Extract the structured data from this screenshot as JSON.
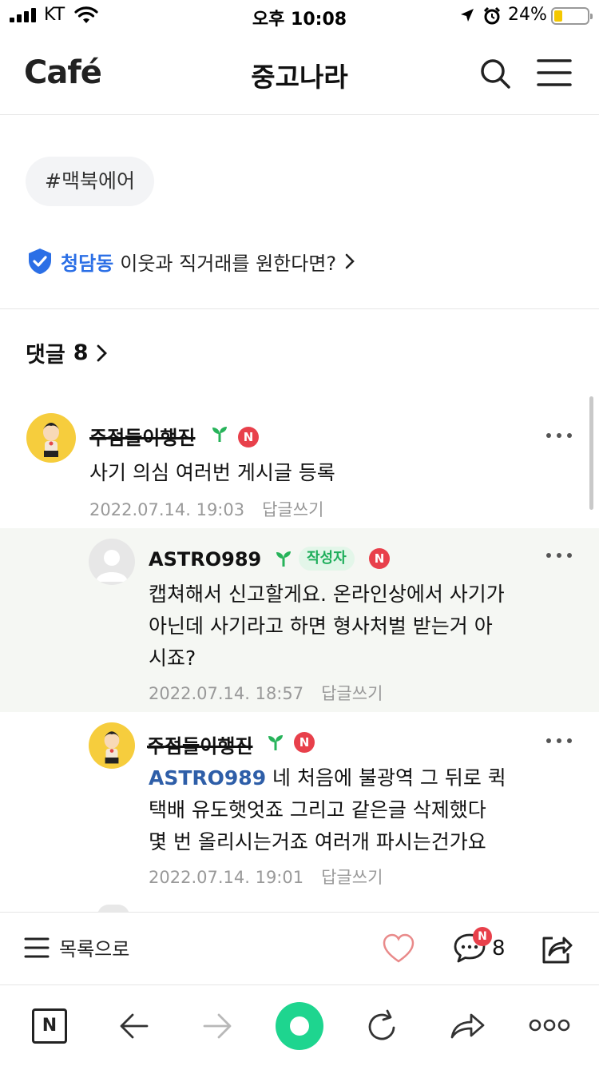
{
  "status_bar": {
    "carrier": "KT",
    "time": "오후 10:08",
    "battery_percent": "24%"
  },
  "header": {
    "logo": "Café",
    "title": "중고나라"
  },
  "tag": "#맥북에어",
  "neighbor": {
    "place": "청담동",
    "text": "이웃과 직거래를 원한다면?"
  },
  "comments_section": {
    "label": "댓글",
    "count": "8"
  },
  "comments": [
    {
      "nickname": "주점둘이행진",
      "badge": "N",
      "text": "사기 의심 여러번 게시글 등록",
      "date": "2022.07.14. 19:03",
      "reply_label": "답글쓰기"
    },
    {
      "nickname": "ASTRO989",
      "author_tag": "작성자",
      "badge": "N",
      "text_line1": "캡쳐해서 신고할게요. 온라인상에서 사기가",
      "text_line2": "아닌데 사기라고 하면 형사처벌 받는거 아",
      "text_line3": "시죠?",
      "date": "2022.07.14. 18:57",
      "reply_label": "답글쓰기"
    },
    {
      "nickname": "주점둘이행진",
      "badge": "N",
      "mention": "ASTRO989",
      "text_line1": " 네 처음에 불광역 그 뒤로 퀵",
      "text_line2": "택배 유도햇엇죠 그리고 같은글 삭제했다",
      "text_line3": "몇 번 올리시는거죠 여러개 파시는건가요",
      "date": "2022.07.14. 19:01",
      "reply_label": "답글쓰기"
    }
  ],
  "action_bar": {
    "list_label": "목록으로",
    "comment_badge": "N",
    "comment_count": "8"
  },
  "browser_bar": {
    "naver_label": "N"
  },
  "colors": {
    "accent_blue": "#2b6fe6",
    "naver_green": "#03c75a",
    "badge_red": "#e8404b"
  }
}
